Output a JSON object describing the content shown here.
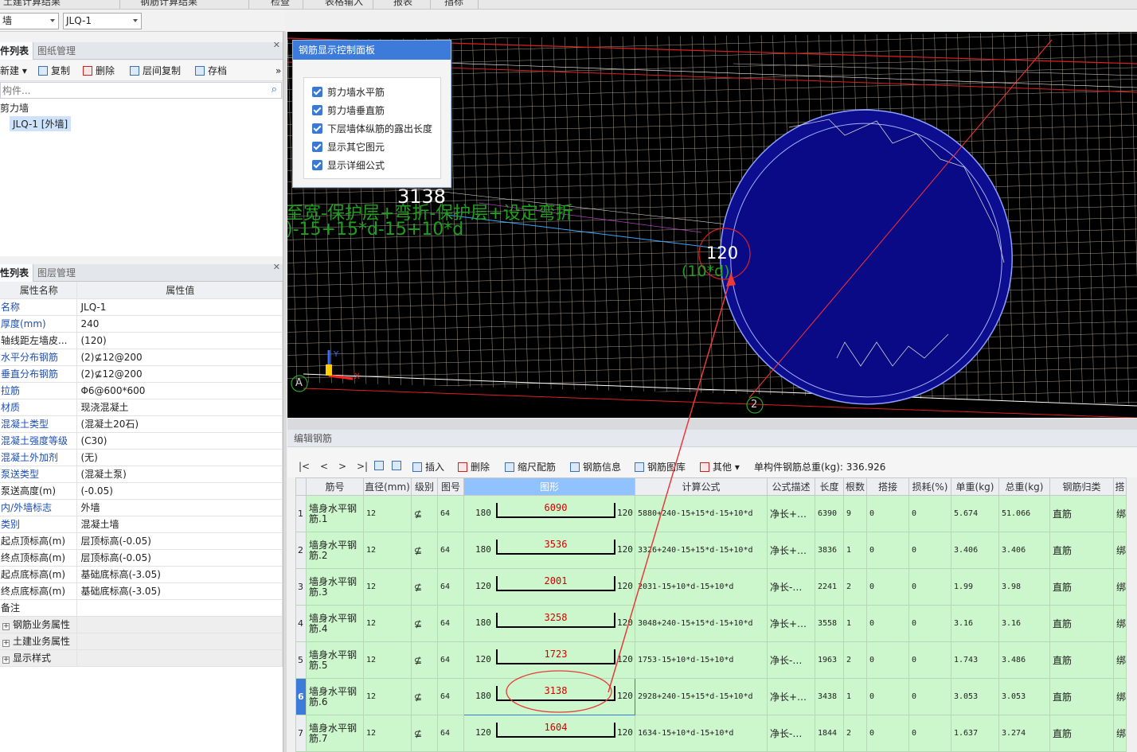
{
  "menu": {
    "items": [
      "土建计算结果",
      "钢筋计算结果",
      "检查",
      "表格输入",
      "报表",
      "指标"
    ]
  },
  "selectors": {
    "component_type": "墙",
    "component_name": "JLQ-1"
  },
  "component_panel": {
    "tabs": [
      "件列表",
      "图纸管理"
    ],
    "toolbar": {
      "new": "新建",
      "copy": "复制",
      "delete": "删除",
      "layer_copy": "层间复制",
      "archive": "存档"
    },
    "search_placeholder": "构件...",
    "tree": {
      "group": "剪力墙",
      "item": "JLQ-1 [外墙]"
    }
  },
  "property_panel": {
    "tabs": [
      "性列表",
      "图层管理"
    ],
    "col_name": "属性名称",
    "col_value": "属性值",
    "rows": [
      {
        "k": "名称",
        "v": "JLQ-1",
        "blue": true
      },
      {
        "k": "厚度(mm)",
        "v": "240",
        "blue": true
      },
      {
        "k": "轴线距左墙皮...",
        "v": "(120)",
        "blue": false
      },
      {
        "k": "水平分布钢筋",
        "v": "(2)⊈12@200",
        "blue": true
      },
      {
        "k": "垂直分布钢筋",
        "v": "(2)⊈12@200",
        "blue": true
      },
      {
        "k": "拉筋",
        "v": "Φ6@600*600",
        "blue": true
      },
      {
        "k": "材质",
        "v": "现浇混凝土",
        "blue": true
      },
      {
        "k": "混凝土类型",
        "v": "(混凝土20石)",
        "blue": true
      },
      {
        "k": "混凝土强度等级",
        "v": "(C30)",
        "blue": true
      },
      {
        "k": "混凝土外加剂",
        "v": "(无)",
        "blue": true
      },
      {
        "k": "泵送类型",
        "v": "(混凝土泵)",
        "blue": true
      },
      {
        "k": "泵送高度(m)",
        "v": "(-0.05)",
        "blue": false
      },
      {
        "k": "内/外墙标志",
        "v": "外墙",
        "blue": true
      },
      {
        "k": "类别",
        "v": "混凝土墙",
        "blue": true
      },
      {
        "k": "起点顶标高(m)",
        "v": "层顶标高(-0.05)",
        "blue": false
      },
      {
        "k": "终点顶标高(m)",
        "v": "层顶标高(-0.05)",
        "blue": false
      },
      {
        "k": "起点底标高(m)",
        "v": "基础底标高(-3.05)",
        "blue": false
      },
      {
        "k": "终点底标高(m)",
        "v": "基础底标高(-3.05)",
        "blue": false
      },
      {
        "k": "备注",
        "v": "",
        "blue": false
      }
    ],
    "groups": [
      "钢筋业务属性",
      "土建业务属性",
      "显示样式"
    ]
  },
  "viewport": {
    "control_panel_title": "钢筋显示控制面板",
    "checkboxes": [
      "剪力墙水平筋",
      "剪力墙垂直筋",
      "下层墙体纵筋的露出长度",
      "显示其它图元",
      "显示详细公式"
    ],
    "label_3138": "3138",
    "formula_text_1": "至宽-保护层+弯折-保护层+设定弯折",
    "formula_text_2": ")-15+15*d-15+10*d",
    "label_120": "120",
    "label_10d": "(10*d)",
    "axis_a": "A",
    "axis_2": "2",
    "axis_x": "X",
    "axis_y": "Y"
  },
  "edit_panel": {
    "title": "编辑钢筋",
    "nav": [
      "|<",
      "<",
      ">",
      ">|"
    ],
    "toolbar": {
      "insert": "插入",
      "delete": "删除",
      "scale": "缩尺配筋",
      "info": "钢筋信息",
      "library": "钢筋图库",
      "other": "其他"
    },
    "total_weight": "单构件钢筋总重(kg): 336.926",
    "columns": [
      "筋号",
      "直径(mm)",
      "级别",
      "图号",
      "图形",
      "计算公式",
      "公式描述",
      "长度",
      "根数",
      "搭接",
      "损耗(%)",
      "单重(kg)",
      "总重(kg)",
      "钢筋归类",
      "搭"
    ],
    "rows": [
      {
        "i": "1",
        "name": "墙身水平钢筋.1",
        "d": "12",
        "grade": "⊈",
        "fig": "64",
        "l": "180",
        "m": "6090",
        "r": "120",
        "formula": "5880+240-15+15*d-15+10*d",
        "desc": "净长+…",
        "len": "6390",
        "n": "9",
        "lap": "0",
        "loss": "0",
        "unit": "5.674",
        "total": "51.066",
        "cat": "直筋",
        "x": "绑"
      },
      {
        "i": "2",
        "name": "墙身水平钢筋.2",
        "d": "12",
        "grade": "⊈",
        "fig": "64",
        "l": "180",
        "m": "3536",
        "r": "120",
        "formula": "3326+240-15+15*d-15+10*d",
        "desc": "净长+…",
        "len": "3836",
        "n": "1",
        "lap": "0",
        "loss": "0",
        "unit": "3.406",
        "total": "3.406",
        "cat": "直筋",
        "x": "绑"
      },
      {
        "i": "3",
        "name": "墙身水平钢筋.3",
        "d": "12",
        "grade": "⊈",
        "fig": "64",
        "l": "120",
        "m": "2001",
        "r": "120",
        "formula": "2031-15+10*d-15+10*d",
        "desc": "净长-…",
        "len": "2241",
        "n": "2",
        "lap": "0",
        "loss": "0",
        "unit": "1.99",
        "total": "3.98",
        "cat": "直筋",
        "x": "绑"
      },
      {
        "i": "4",
        "name": "墙身水平钢筋.4",
        "d": "12",
        "grade": "⊈",
        "fig": "64",
        "l": "180",
        "m": "3258",
        "r": "120",
        "formula": "3048+240-15+15*d-15+10*d",
        "desc": "净长+…",
        "len": "3558",
        "n": "1",
        "lap": "0",
        "loss": "0",
        "unit": "3.16",
        "total": "3.16",
        "cat": "直筋",
        "x": "绑"
      },
      {
        "i": "5",
        "name": "墙身水平钢筋.5",
        "d": "12",
        "grade": "⊈",
        "fig": "64",
        "l": "120",
        "m": "1723",
        "r": "120",
        "formula": "1753-15+10*d-15+10*d",
        "desc": "净长-…",
        "len": "1963",
        "n": "2",
        "lap": "0",
        "loss": "0",
        "unit": "1.743",
        "total": "3.486",
        "cat": "直筋",
        "x": "绑"
      },
      {
        "i": "6",
        "name": "墙身水平钢筋.6",
        "d": "12",
        "grade": "⊈",
        "fig": "64",
        "l": "180",
        "m": "3138",
        "r": "120",
        "formula": "2928+240-15+15*d-15+10*d",
        "desc": "净长+…",
        "len": "3438",
        "n": "1",
        "lap": "0",
        "loss": "0",
        "unit": "3.053",
        "total": "3.053",
        "cat": "直筋",
        "x": "绑"
      },
      {
        "i": "7",
        "name": "墙身水平钢筋.7",
        "d": "12",
        "grade": "⊈",
        "fig": "64",
        "l": "120",
        "m": "1604",
        "r": "120",
        "formula": "1634-15+10*d-15+10*d",
        "desc": "净长-…",
        "len": "1844",
        "n": "2",
        "lap": "0",
        "loss": "0",
        "unit": "1.637",
        "total": "3.274",
        "cat": "直筋",
        "x": "绑"
      }
    ],
    "selected_row": "6"
  }
}
